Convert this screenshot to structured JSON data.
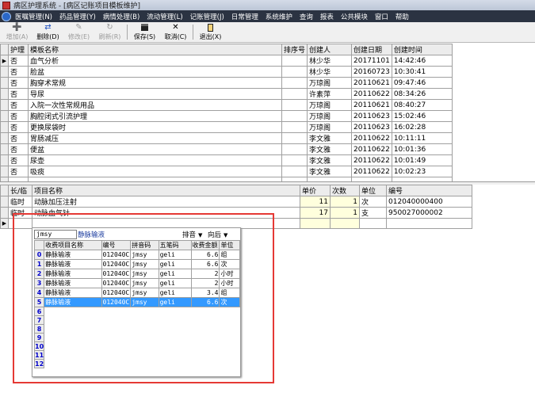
{
  "window": {
    "title": "病区护理系统 - [病区记账项目模板维护]"
  },
  "menu": [
    "医嘱管理(N)",
    "药品管理(Y)",
    "病情处理(B)",
    "流动管理(L)",
    "记账管理(J)",
    "日常管理",
    "系统维护",
    "查询",
    "报表",
    "公共模块",
    "窗口",
    "帮助"
  ],
  "toolbar": {
    "add": "增加(A)",
    "delete": "删除(D)",
    "modify": "修改(E)",
    "refresh": "刷新(R)",
    "save": "保存(S)",
    "cancel": "取消(C)",
    "exit": "退出(X)"
  },
  "templates": {
    "columns": [
      "护理",
      "模板名称",
      "排序号",
      "创建人",
      "创建日期",
      "创建时间"
    ],
    "rows": [
      {
        "care": "否",
        "name": "血气分析",
        "sort": "",
        "creator": "林少华",
        "date": "20171101",
        "time": "14:42:46"
      },
      {
        "care": "否",
        "name": "脸盆",
        "sort": "",
        "creator": "林少华",
        "date": "20160723",
        "time": "10:30:41"
      },
      {
        "care": "否",
        "name": "胸穿术常规",
        "sort": "",
        "creator": "万琼阁",
        "date": "20110621",
        "time": "09:47:46"
      },
      {
        "care": "否",
        "name": "导尿",
        "sort": "",
        "creator": "许素萍",
        "date": "20110622",
        "time": "08:34:26"
      },
      {
        "care": "否",
        "name": "入院一次性常规用品",
        "sort": "",
        "creator": "万琼阁",
        "date": "20110621",
        "time": "08:40:27"
      },
      {
        "care": "否",
        "name": "胸腔闭式引流护理",
        "sort": "",
        "creator": "万琼阁",
        "date": "20110623",
        "time": "15:02:46"
      },
      {
        "care": "否",
        "name": "更换尿袋时",
        "sort": "",
        "creator": "万琼阁",
        "date": "20110623",
        "time": "16:02:28"
      },
      {
        "care": "否",
        "name": "胃肠减压",
        "sort": "",
        "creator": "李文雅",
        "date": "20110622",
        "time": "10:11:11"
      },
      {
        "care": "否",
        "name": "便盆",
        "sort": "",
        "creator": "李文雅",
        "date": "20110622",
        "time": "10:01:36"
      },
      {
        "care": "否",
        "name": "尿壶",
        "sort": "",
        "creator": "李文雅",
        "date": "20110622",
        "time": "10:01:49"
      },
      {
        "care": "否",
        "name": "吸痰",
        "sort": "",
        "creator": "李文雅",
        "date": "20110622",
        "time": "10:02:23"
      }
    ]
  },
  "items": {
    "columns": [
      "长/临",
      "项目名称",
      "单价",
      "次数",
      "单位",
      "编号"
    ],
    "rows": [
      {
        "type": "临时",
        "name": "动脉加压注射",
        "price": "11",
        "count": "1",
        "unit": "次",
        "code": "012040000400"
      },
      {
        "type": "临时",
        "name": "动脉血气针",
        "price": "17",
        "count": "1",
        "unit": "支",
        "code": "950027000002"
      }
    ]
  },
  "popup": {
    "search_value": "jmsy",
    "caption": "静脉输液",
    "sort_label": "排音",
    "order_label": "向后",
    "columns": [
      "收费项目名称",
      "编号",
      "拼音码",
      "五笔码",
      "收费金额",
      "单位"
    ],
    "rows": [
      {
        "n": "0",
        "name": "静脉输液",
        "code": "012040C",
        "py": "jmsy",
        "wb": "geli",
        "amt": "6.6",
        "unit": "组"
      },
      {
        "n": "1",
        "name": "静脉输液",
        "code": "012040C",
        "py": "jmsy",
        "wb": "geli",
        "amt": "6.6",
        "unit": "次"
      },
      {
        "n": "2",
        "name": "静脉输液",
        "code": "012040C",
        "py": "jmsy",
        "wb": "geli",
        "amt": "2",
        "unit": "小时"
      },
      {
        "n": "3",
        "name": "静脉输液",
        "code": "012040C",
        "py": "jmsy",
        "wb": "geli",
        "amt": "2",
        "unit": "小时"
      },
      {
        "n": "4",
        "name": "静脉输液",
        "code": "012040C",
        "py": "jmsy",
        "wb": "geli",
        "amt": "3.4",
        "unit": "组"
      },
      {
        "n": "5",
        "name": "静脉输液",
        "code": "012040C",
        "py": "jmsy",
        "wb": "geli",
        "amt": "6.6",
        "unit": "次"
      }
    ],
    "empty_rows": [
      "6",
      "7",
      "8",
      "9",
      "10",
      "11",
      "12"
    ],
    "selected_index": 5
  }
}
